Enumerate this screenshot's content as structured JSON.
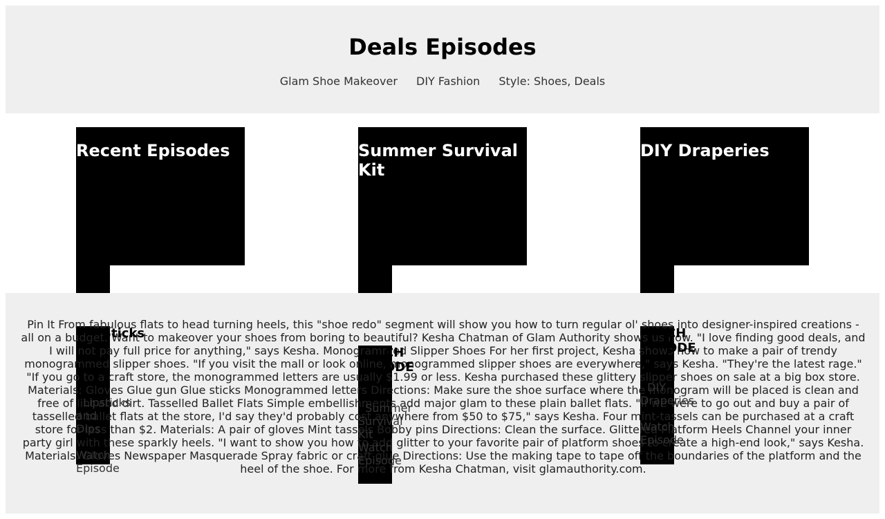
{
  "header": {
    "title": "Deals Episodes",
    "nav": [
      "Glam Shoe Makeover",
      "DIY Fashion",
      "Style: Shoes, Deals"
    ]
  },
  "cards": [
    {
      "title": "Recent Episodes"
    },
    {
      "title": "Summer Survival Kit"
    },
    {
      "title": "DIY Draperies"
    }
  ],
  "overlays": {
    "col1_bold": "Sticks",
    "col1_lines": [
      "Lipsticks",
      "and",
      "Dips",
      "Watch",
      "Episode"
    ],
    "col2_bold": "CH\nODE",
    "col2_lines": [
      "Summer",
      "Survival",
      "Kit",
      "Watch",
      "Episode"
    ],
    "col3_bold": "CH\nODE",
    "col3_lines": [
      "DIY",
      "Draperies",
      "Watch",
      "Episode"
    ]
  },
  "article": "Pin It     From fabulous flats to head turning heels, this \"shoe redo\" segment will show you how to turn regular ol' shoes into designer-inspired creations - all on a budget.     Want to makeover your shoes from boring to beautiful? Kesha Chatman of Glam Authority shows us how.     \"I love finding good deals, and I will not pay full price for anything,\" says Kesha.     Monogrammed Slipper Shoes     For her first project, Kesha shows how to make a pair of trendy monogrammed slipper shoes.     \"If you visit the mall or look online, monogrammed slipper shoes are everywhere,\" says Kesha.     \"They're the latest rage.\"     \"If you go to a craft store, the monogrammed letters are usually $1.99 or less. Kesha purchased these glittery slipper shoes on sale at a big box store.     Materials:     Gloves     Glue gun     Glue sticks     Monogrammed letters     Directions:     Make sure the shoe surface where the monogram will be placed is clean and free of lint and dirt.     Tasselled Ballet Flats     Simple embellishments add major glam to these plain ballet flats.     \"If we were to go out and buy a pair of tasselled ballet flats at the store, I'd say they'd probably cost anywhere from $50 to $75,\" says Kesha.     Four mint-tassels can be purchased at a craft store for less than $2.     Materials:     A pair of gloves     Mint tassels     Bobby pins     Directions:     Clean the surface.     Glittered Platform Heels     Channel your inner party girl with these sparkly heels.     \"I want to show you how to add glitter to your favorite pair of platform shoes to create a high-end look,\" says Kesha.     Materials:     Gloves     Newspaper     Masquerade     Spray fabric or craft glue     Directions:     Use the making tape to tape off the boundaries of the platform and the heel of the shoe.     For more from Kesha Chatman, visit glamauthority.com."
}
